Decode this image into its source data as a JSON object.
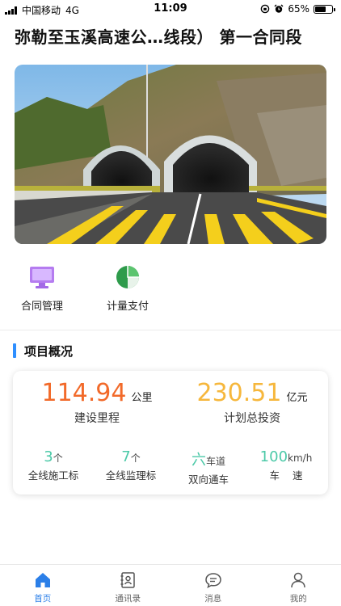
{
  "status_bar": {
    "carrier": "中国移动",
    "network": "4G",
    "time": "11:09",
    "battery": "65%",
    "battery_level": 0.65
  },
  "header": {
    "title": "弥勒至玉溪高速公…线段）  第一合同段"
  },
  "quick_menu": [
    {
      "label": "合同管理",
      "icon": "monitor-icon",
      "color": "#b57cf0"
    },
    {
      "label": "计量支付",
      "icon": "pie-chart-icon",
      "color": "#2e9b4b"
    }
  ],
  "overview": {
    "section_title": "项目概况",
    "mileage": {
      "value": "114.94",
      "unit": "公里",
      "caption": "建设里程",
      "color": "#f26a2a"
    },
    "investment": {
      "value": "230.51",
      "unit": "亿元",
      "caption": "计划总投资",
      "color": "#f6b73c"
    },
    "construction_sections": {
      "value": "3",
      "unit": "个",
      "caption": "全线施工标"
    },
    "supervision_sections": {
      "value": "7",
      "unit": "个",
      "caption": "全线监理标"
    },
    "lanes": {
      "value": "六",
      "unit": "车道",
      "caption": "双向通车"
    },
    "speed": {
      "value": "100",
      "unit": "km/h",
      "caption": "车    速"
    }
  },
  "tab_bar": {
    "tabs": [
      {
        "label": "首页",
        "icon": "home-icon",
        "active": true
      },
      {
        "label": "通讯录",
        "icon": "contacts-icon",
        "active": false
      },
      {
        "label": "消息",
        "icon": "message-icon",
        "active": false
      },
      {
        "label": "我的",
        "icon": "user-icon",
        "active": false
      }
    ],
    "active_color": "#2b7fe8"
  }
}
